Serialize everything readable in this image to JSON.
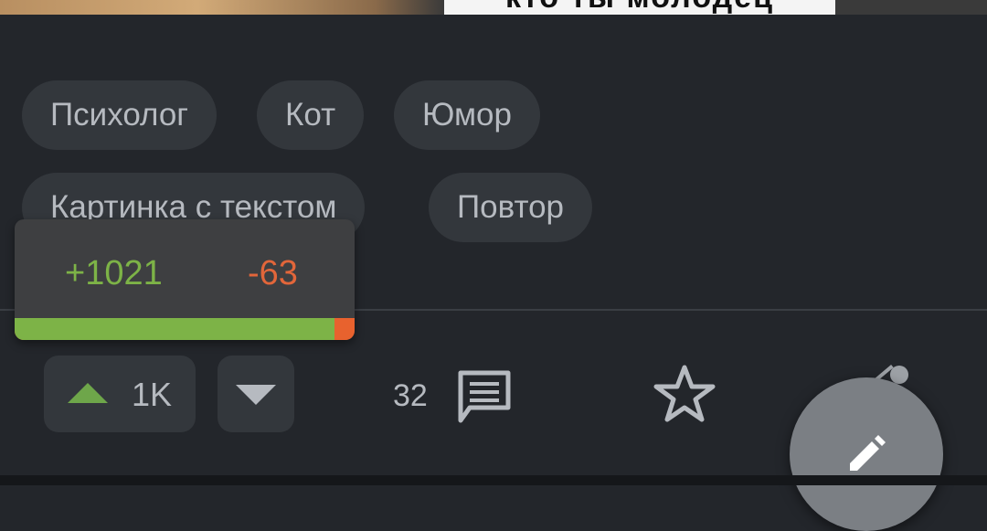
{
  "post_image": {
    "caption_fragment": "кто ты молодец"
  },
  "tags": [
    "Психолог",
    "Кот",
    "Юмор",
    "Картинка с текстом",
    "Повтор"
  ],
  "rating_popup": {
    "pluses": "+1021",
    "minuses": "-63",
    "positive_fraction": 0.942,
    "colors": {
      "positive": "#7db347",
      "negative": "#e2663a"
    }
  },
  "actions": {
    "upvote_count": "1K",
    "comments_count": "32",
    "upvote_icon": "triangle-up-icon",
    "downvote_icon": "triangle-down-icon",
    "comments_icon": "comment-icon",
    "save_icon": "star-icon",
    "fab_icon": "pencil-icon"
  }
}
